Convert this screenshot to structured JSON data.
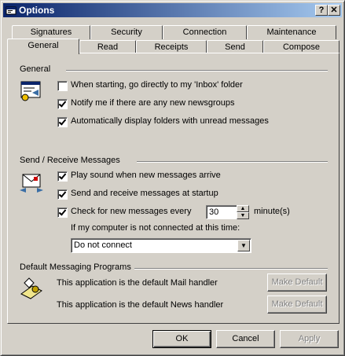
{
  "window": {
    "title": "Options",
    "help_button": "?",
    "close_button": "✕"
  },
  "tabs_back": [
    "Signatures",
    "Security",
    "Connection",
    "Maintenance"
  ],
  "tabs_front": [
    "General",
    "Read",
    "Receipts",
    "Send",
    "Compose"
  ],
  "general_group": {
    "title": "General",
    "icon": "settings-window-icon",
    "options": [
      {
        "label": "When starting, go directly to my 'Inbox' folder",
        "checked": false
      },
      {
        "label": "Notify me if there are any new newsgroups",
        "checked": true
      },
      {
        "label": "Automatically display folders with unread messages",
        "checked": true
      }
    ]
  },
  "send_receive_group": {
    "title": "Send / Receive Messages",
    "icon": "envelope-icon",
    "options": [
      {
        "label": "Play sound when new messages arrive",
        "checked": true
      },
      {
        "label": "Send and receive messages at startup",
        "checked": true
      },
      {
        "label": "Check for new messages every",
        "checked": true
      }
    ],
    "interval_value": "30",
    "interval_unit": "minute(s)",
    "offline_label": "If my computer is not connected at this time:",
    "offline_selected": "Do not connect"
  },
  "default_programs_group": {
    "title": "Default Messaging Programs",
    "icon": "mail-handler-icon",
    "mail_text": "This application is the default Mail handler",
    "news_text": "This application is the default News handler",
    "make_default_label": "Make Default"
  },
  "footer": {
    "ok_label": "OK",
    "cancel_label": "Cancel",
    "apply_label": "Apply"
  }
}
